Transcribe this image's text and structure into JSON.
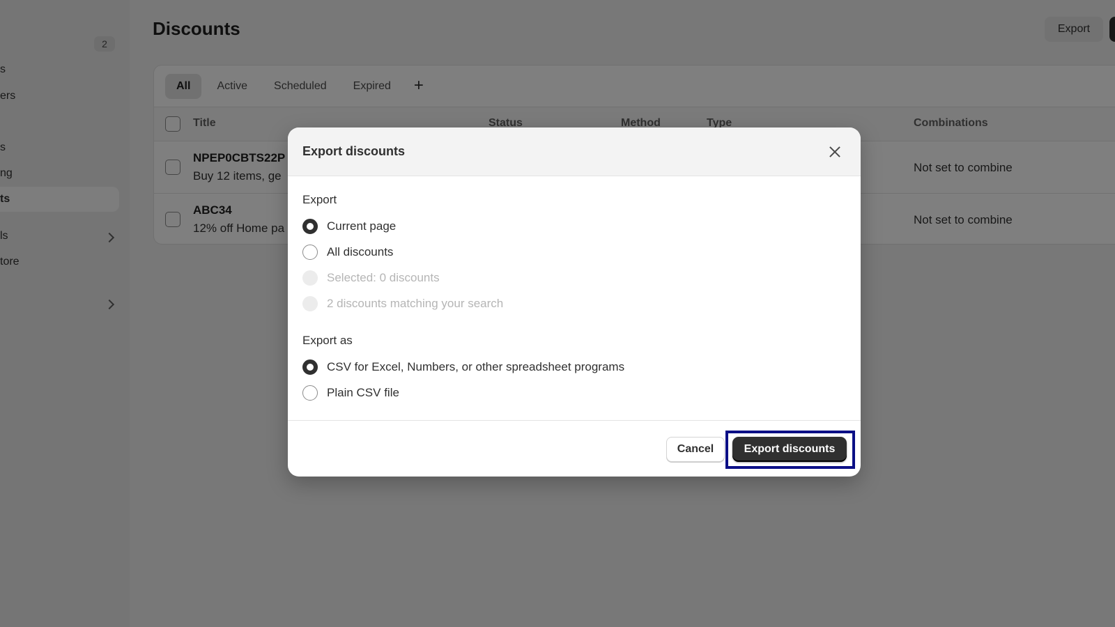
{
  "sidebar": {
    "badge": "2",
    "items": [
      {
        "label": "s"
      },
      {
        "label": "ers"
      },
      {
        "label": "s"
      },
      {
        "label": "ng"
      },
      {
        "label": "ts"
      },
      {
        "label": "ls"
      },
      {
        "label": "tore"
      }
    ]
  },
  "header": {
    "title": "Discounts",
    "export_label": "Export"
  },
  "tabs": [
    {
      "label": "All"
    },
    {
      "label": "Active"
    },
    {
      "label": "Scheduled"
    },
    {
      "label": "Expired"
    }
  ],
  "add_tab_symbol": "+",
  "table": {
    "columns": [
      "Title",
      "Status",
      "Method",
      "Type",
      "Combinations"
    ],
    "rows": [
      {
        "title": "NPEP0CBTS22P",
        "subtitle": "Buy 12 items, ge",
        "combinations": "Not set to combine"
      },
      {
        "title": "ABC34",
        "subtitle": "12% off Home pa",
        "combinations": "Not set to combine"
      }
    ]
  },
  "modal": {
    "title": "Export discounts",
    "export_label": "Export",
    "export_options": [
      {
        "label": "Current page",
        "state": "checked"
      },
      {
        "label": "All discounts",
        "state": "unchecked"
      },
      {
        "label": "Selected: 0 discounts",
        "state": "disabled"
      },
      {
        "label": "2 discounts matching your search",
        "state": "disabled"
      }
    ],
    "export_as_label": "Export as",
    "format_options": [
      {
        "label": "CSV for Excel, Numbers, or other spreadsheet programs",
        "state": "checked"
      },
      {
        "label": "Plain CSV file",
        "state": "unchecked"
      }
    ],
    "cancel_label": "Cancel",
    "submit_label": "Export discounts"
  },
  "colors": {
    "primary_button": "#303030",
    "highlight_outline": "#0b0f86",
    "backdrop": "rgba(0,0,0,0.5)"
  }
}
